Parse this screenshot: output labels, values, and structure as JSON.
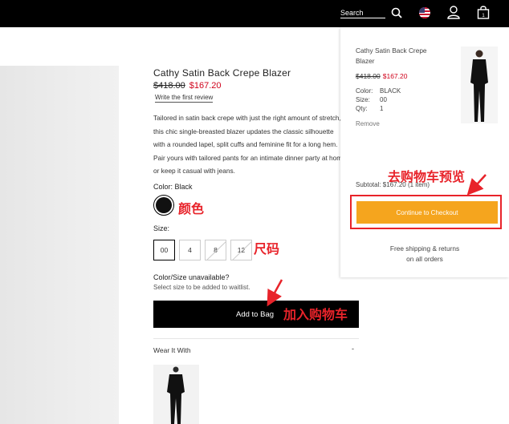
{
  "header": {
    "search_label": "Search",
    "icons": [
      "search-icon",
      "us-flag-icon",
      "account-icon",
      "bag-icon"
    ]
  },
  "product": {
    "title": "Cathy Satin Back Crepe Blazer",
    "price_old": "$418.00",
    "price_new": "$167.20",
    "review_link": "Write the first review",
    "description": "Tailored in satin back crepe with just the right amount of stretch, this chic single-breasted blazer updates the classic silhouette with a rounded lapel, split cuffs and feminine fit for a long hem. Pair yours with tailored pants for an intimate dinner party at home or keep it casual with jeans.",
    "color_label": "Color: Black",
    "size_label": "Size:",
    "sizes": [
      "00",
      "4",
      "8",
      "12"
    ],
    "selected_size": "00",
    "unavailable_label": "Color/Size unavailable?",
    "unavailable_sub": "Select size to be added to waitlist.",
    "add_to_bag": "Add to Bag",
    "wear_it_with": "Wear It With",
    "wear_toggle": "-"
  },
  "cart": {
    "item_name": "Cathy Satin Back Crepe Blazer",
    "price_old": "$418.00",
    "price_new": "$167.20",
    "color_key": "Color:",
    "color_value": "BLACK",
    "size_key": "Size:",
    "size_value": "00",
    "qty_key": "Qty:",
    "qty_value": "1",
    "remove": "Remove",
    "subtotal": "Subtotal: $167.20 (1 item)",
    "checkout": "Continue to Checkout",
    "shipping_line1": "Free shipping & returns",
    "shipping_line2": "on all orders"
  },
  "annotations": {
    "color": "颜色",
    "size": "尺码",
    "add_to_cart": "加入购物车",
    "preview_cart": "去购物车预览"
  },
  "colors": {
    "accent": "#f5a51e",
    "sale": "#d0021b",
    "annotation": "#e8232a"
  }
}
